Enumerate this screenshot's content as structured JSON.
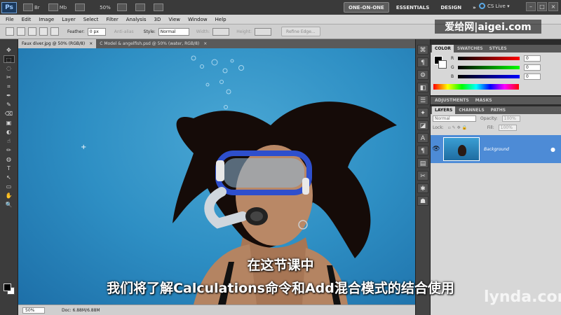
{
  "appbar": {
    "logo": "Ps",
    "br_label": "Br",
    "mb_label": "Mb",
    "zoom": "50%",
    "workspaces": [
      "ONE-ON-ONE",
      "ESSENTIALS",
      "DESIGN"
    ],
    "more": "»",
    "cs_live": "CS Live ▾",
    "window_controls": [
      "–",
      "□",
      "×"
    ]
  },
  "menu": [
    "File",
    "Edit",
    "Image",
    "Layer",
    "Select",
    "Filter",
    "Analysis",
    "3D",
    "View",
    "Window",
    "Help"
  ],
  "options": {
    "feather_label": "Feather:",
    "feather_value": "0 px",
    "antialias": "Anti-alias",
    "style_label": "Style:",
    "style_value": "Normal",
    "width_label": "Width:",
    "height_label": "Height:",
    "refine_edge": "Refine Edge..."
  },
  "watermark": "爱给网|aigei.com",
  "tools": [
    "✥",
    "⬚",
    "◌",
    "✂",
    "⌗",
    "✒",
    "✎",
    "⌫",
    "▣",
    "◐",
    "☝",
    "✏",
    "◍",
    "T",
    "↖",
    "▭",
    "✋",
    "🔍"
  ],
  "doc_tabs": [
    {
      "label": "Faux diver.jpg @ 50% (RGB/8)",
      "close": "×"
    },
    {
      "label": "C Model & angelfish.psd @ 50% (water, RGB/8)",
      "close": "×"
    }
  ],
  "status": {
    "zoom": "50%",
    "doc": "Doc: 6.88M/6.88M"
  },
  "dock_icons": [
    "⌘",
    "¶",
    "⚙",
    "◧",
    "☰",
    "✦",
    "◪",
    "A",
    "¶",
    "▤",
    "✂",
    "✱",
    "☗"
  ],
  "color_panel": {
    "tabs": [
      "COLOR",
      "SWATCHES",
      "STYLES"
    ],
    "channels": [
      {
        "label": "R",
        "value": "0",
        "color": "#ff0000"
      },
      {
        "label": "G",
        "value": "0",
        "color": "#00ff00"
      },
      {
        "label": "B",
        "value": "0",
        "color": "#0000ff"
      }
    ]
  },
  "adjust_panel": {
    "tabs": [
      "ADJUSTMENTS",
      "MASKS"
    ]
  },
  "layers_panel": {
    "tabs": [
      "LAYERS",
      "CHANNELS",
      "PATHS"
    ],
    "blend_mode": "Normal",
    "opacity_label": "Opacity:",
    "opacity": "100%",
    "lock_label": "Lock:",
    "fill_label": "Fill:",
    "fill": "100%",
    "layer_name": "Background"
  },
  "subtitles": {
    "line1": "在这节课中",
    "line2": "我们将了解Calculations命令和Add混合模式的结合使用"
  },
  "lynda": "lynda.com"
}
